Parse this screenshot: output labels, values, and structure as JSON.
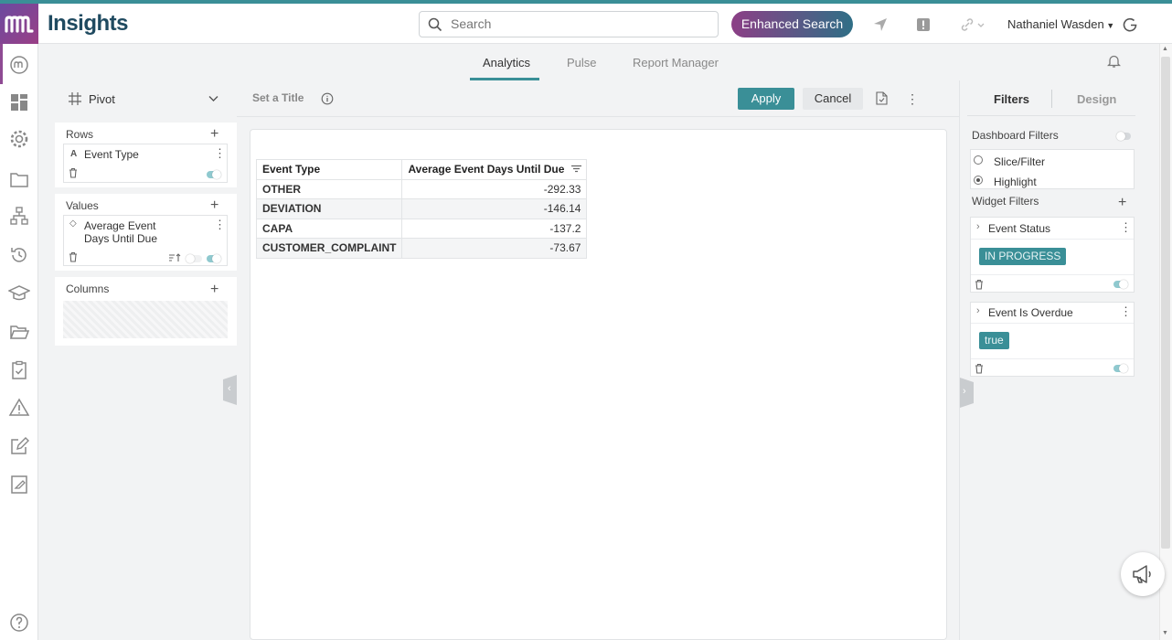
{
  "app": {
    "title": "Insights"
  },
  "header": {
    "search_placeholder": "Search",
    "enhanced_search_label": "Enhanced Search",
    "user_name": "Nathaniel Wasden"
  },
  "tabs": [
    {
      "label": "Analytics",
      "active": true
    },
    {
      "label": "Pulse",
      "active": false
    },
    {
      "label": "Report Manager",
      "active": false
    }
  ],
  "pivot_panel": {
    "widget_type": "Pivot",
    "rows": {
      "label": "Rows",
      "fields": [
        "Event Type"
      ]
    },
    "values": {
      "label": "Values",
      "fields": [
        "Average Event Days Until Due"
      ]
    },
    "columns": {
      "label": "Columns",
      "fields": []
    }
  },
  "toolbar": {
    "title_placeholder": "Set a Title",
    "apply_label": "Apply",
    "cancel_label": "Cancel"
  },
  "table": {
    "columns": [
      "Event Type",
      "Average Event Days Until Due"
    ],
    "rows": [
      {
        "type": "OTHER",
        "value": "-292.33"
      },
      {
        "type": "DEVIATION",
        "value": "-146.14"
      },
      {
        "type": "CAPA",
        "value": "-137.2"
      },
      {
        "type": "CUSTOMER_COMPLAINT",
        "value": "-73.67"
      }
    ]
  },
  "right_panel": {
    "tabs": [
      "Filters",
      "Design"
    ],
    "dashboard_filters_label": "Dashboard Filters",
    "filter_modes": [
      {
        "label": "Slice/Filter",
        "selected": false
      },
      {
        "label": "Highlight",
        "selected": true
      }
    ],
    "widget_filters_label": "Widget Filters",
    "widget_filters": [
      {
        "name": "Event Status",
        "value": "IN PROGRESS"
      },
      {
        "name": "Event Is Overdue",
        "value": "true"
      }
    ]
  },
  "colors": {
    "accent": "#3a8f97",
    "brand_purple": "#8c3f86",
    "brand_navy": "#1f4a60"
  }
}
